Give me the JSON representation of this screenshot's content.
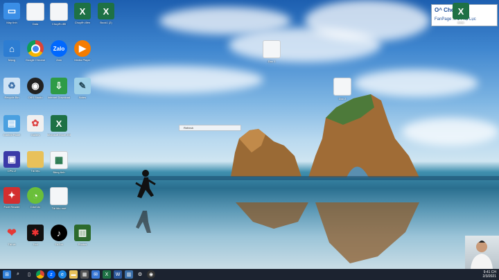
{
  "desktop_icons": [
    {
      "label": "Máy tính",
      "kind": "pc"
    },
    {
      "label": "Data",
      "kind": "folder"
    },
    {
      "label": "Chuyển đổi",
      "kind": "doc"
    },
    {
      "label": "Chuyển điền",
      "kind": "xls"
    },
    {
      "label": "Book1 (2)",
      "kind": "xls"
    },
    {
      "label": "Mạng",
      "kind": "network"
    },
    {
      "label": "Google Chrome",
      "kind": "chrome"
    },
    {
      "label": "Zalo",
      "kind": "zalo"
    },
    {
      "label": "Media Player",
      "kind": "media"
    },
    {
      "label": "Recycle Bin",
      "kind": "bin"
    },
    {
      "label": "OBS Studio",
      "kind": "obs"
    },
    {
      "label": "Internet Download",
      "kind": "idm"
    },
    {
      "label": "Notes",
      "kind": "note"
    },
    {
      "label": "Control Panel",
      "kind": "panel"
    },
    {
      "label": "Gallery",
      "kind": "gallery"
    },
    {
      "label": "Microsoft Excel 2016",
      "kind": "xls"
    },
    {
      "label": "CPU-Z",
      "kind": "cpu"
    },
    {
      "label": "Tài liệu",
      "kind": "folder"
    },
    {
      "label": "Bảng tính",
      "kind": "sheet"
    },
    {
      "label": "Foxit Reader",
      "kind": "foxit"
    },
    {
      "label": "CốcCốc",
      "kind": "coccoc"
    },
    {
      "label": "Tài liệu mới",
      "kind": "doc"
    },
    {
      "label": "Tải về",
      "kind": "pin"
    },
    {
      "label": "Tool",
      "kind": "tool"
    },
    {
      "label": "TikTok",
      "kind": "tiktok"
    },
    {
      "label": "Photos",
      "kind": "photo"
    }
  ],
  "center_files": [
    {
      "label": "Doc 1"
    },
    {
      "label": "Doc 2"
    }
  ],
  "context_tooltip": "Refresh",
  "fb_card": {
    "line1": "O^ Che.c",
    "line2": "FanPage ... 1 Phụ Lục"
  },
  "top_right_doc": {
    "label": "Book"
  },
  "taskbar": {
    "icons": [
      "start",
      "search",
      "task-view",
      "chrome",
      "zalo",
      "edge",
      "explorer",
      "store",
      "mail",
      "excel",
      "word",
      "photos",
      "settings",
      "obs"
    ],
    "clock": "9:41 CH",
    "date": "2/3/2021"
  }
}
